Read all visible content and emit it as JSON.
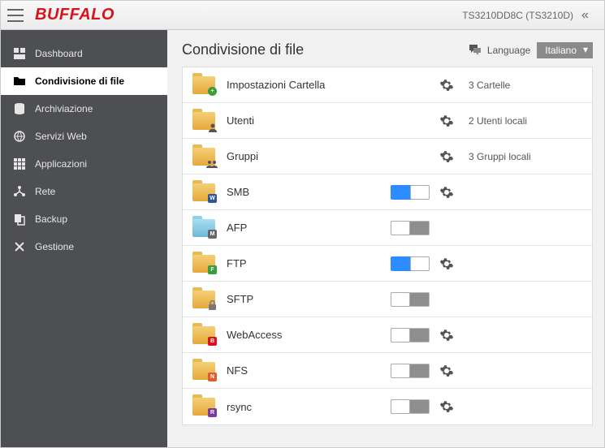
{
  "header": {
    "logo": "BUFFALO",
    "device": "TS3210DD8C (TS3210D)"
  },
  "sidebar": {
    "items": [
      {
        "label": "Dashboard",
        "icon": "dashboard-icon",
        "active": false
      },
      {
        "label": "Condivisione di file",
        "icon": "folder-icon",
        "active": true
      },
      {
        "label": "Archiviazione",
        "icon": "storage-icon",
        "active": false
      },
      {
        "label": "Servizi Web",
        "icon": "globe-icon",
        "active": false
      },
      {
        "label": "Applicazioni",
        "icon": "apps-icon",
        "active": false
      },
      {
        "label": "Rete",
        "icon": "network-icon",
        "active": false
      },
      {
        "label": "Backup",
        "icon": "backup-icon",
        "active": false
      },
      {
        "label": "Gestione",
        "icon": "tools-icon",
        "active": false
      }
    ]
  },
  "page": {
    "title": "Condivisione di file",
    "language_label": "Language",
    "language_value": "Italiano"
  },
  "rows": [
    {
      "label": "Impostazioni Cartella",
      "icon": "folder-plus",
      "has_gear": true,
      "stat": "3 Cartelle"
    },
    {
      "label": "Utenti",
      "icon": "folder-user",
      "has_gear": true,
      "stat": "2 Utenti locali"
    },
    {
      "label": "Gruppi",
      "icon": "folder-group",
      "has_gear": true,
      "stat": "3 Gruppi locali"
    },
    {
      "label": "SMB",
      "icon": "folder-w",
      "toggle": true,
      "has_gear": true
    },
    {
      "label": "AFP",
      "icon": "folder-m",
      "toggle": false,
      "has_gear": false
    },
    {
      "label": "FTP",
      "icon": "folder-f",
      "toggle": true,
      "has_gear": true
    },
    {
      "label": "SFTP",
      "icon": "folder-lock",
      "toggle": false,
      "has_gear": false
    },
    {
      "label": "WebAccess",
      "icon": "folder-b",
      "toggle": false,
      "has_gear": true
    },
    {
      "label": "NFS",
      "icon": "folder-n",
      "toggle": false,
      "has_gear": true
    },
    {
      "label": "rsync",
      "icon": "folder-r",
      "toggle": false,
      "has_gear": true
    }
  ],
  "colors": {
    "brand_red": "#d8131b",
    "sidebar_bg": "#4e4f52",
    "toggle_on": "#2d8cff",
    "folder_yellow": "#e6a93b",
    "folder_blue": "#6db8d4"
  }
}
